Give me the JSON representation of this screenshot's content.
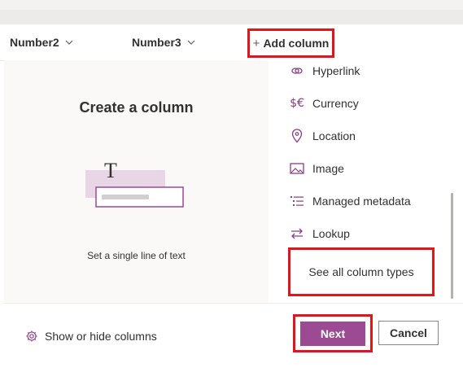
{
  "header": {
    "columns": [
      {
        "label": "Number2",
        "icon": "chevron-down-icon"
      },
      {
        "label": "Number3",
        "icon": "chevron-down-icon"
      }
    ],
    "add_column": {
      "icon": "plus-icon",
      "label": "Add column"
    }
  },
  "dialog": {
    "title": "Create a column",
    "illustration_glyph": "T",
    "description": "Set a single line of text"
  },
  "column_types": [
    {
      "label": "Hyperlink",
      "icon": "link-icon"
    },
    {
      "label": "Currency",
      "icon": "currency-icon",
      "glyph": "$€"
    },
    {
      "label": "Location",
      "icon": "location-pin-icon"
    },
    {
      "label": "Image",
      "icon": "image-icon"
    },
    {
      "label": "Managed metadata",
      "icon": "managed-metadata-icon"
    },
    {
      "label": "Lookup",
      "icon": "lookup-icon"
    }
  ],
  "see_all": {
    "label": "See all column types"
  },
  "footer": {
    "show_hide": {
      "label": "Show or hide columns",
      "icon": "gear-icon"
    },
    "next_label": "Next",
    "cancel_label": "Cancel"
  },
  "colors": {
    "accent": "#9b4a93",
    "highlight_border": "#e0161e",
    "icon": "#8a3d86"
  }
}
